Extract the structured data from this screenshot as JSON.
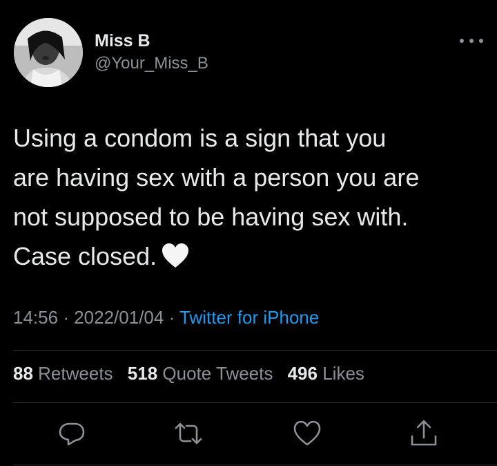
{
  "user": {
    "display_name": "Miss B",
    "handle": "@Your_Miss_B",
    "avatar_icon": "profile-photo"
  },
  "tweet": {
    "lines": [
      "Using a condom is a sign that you",
      "are having sex with a person you are",
      "not supposed to be having sex with.",
      "Case closed."
    ],
    "emoji": "white-heart"
  },
  "meta": {
    "time": "14:56",
    "separator": "·",
    "date": "2022/01/04",
    "source": "Twitter for iPhone"
  },
  "stats": {
    "retweets_count": "88",
    "retweets_label": "Retweets",
    "quotes_count": "518",
    "quotes_label": "Quote Tweets",
    "likes_count": "496",
    "likes_label": "Likes"
  },
  "actions": [
    "reply-icon",
    "retweet-icon",
    "like-icon",
    "share-icon"
  ],
  "colors": {
    "background": "#000000",
    "text": "#e7e9ea",
    "muted": "#8b9196",
    "link": "#1d9bf0",
    "divider": "#2f3336"
  }
}
